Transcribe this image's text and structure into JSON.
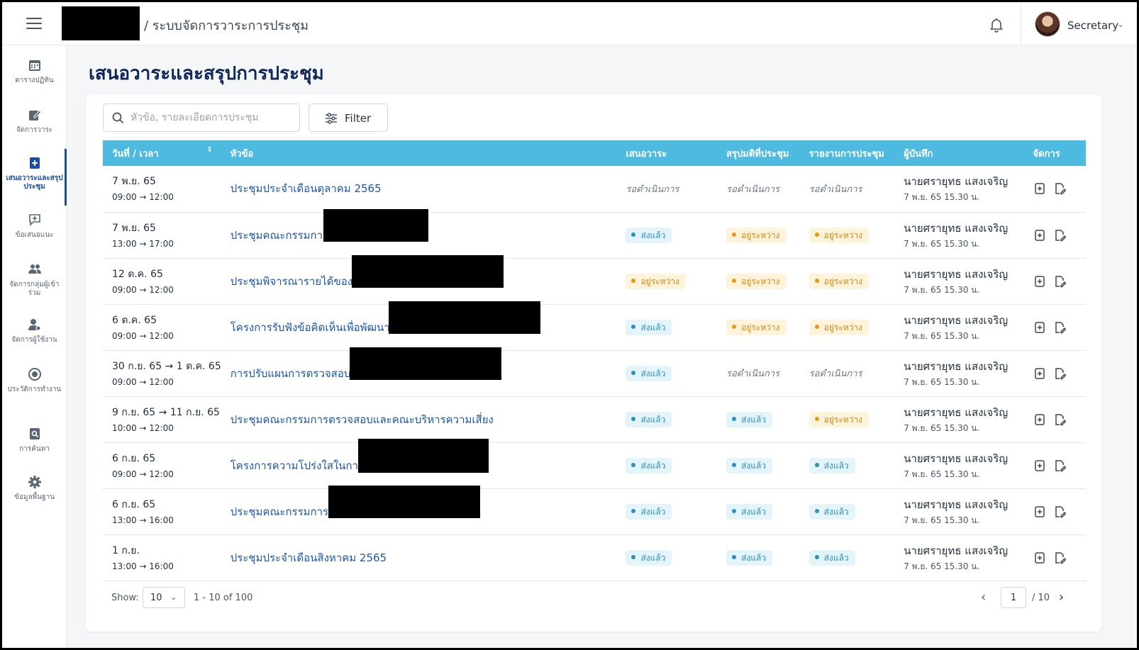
{
  "header": {
    "app_title": "/ ระบบจัดการวาระการประชุม",
    "user_name": "Secretary"
  },
  "sidebar": {
    "items": [
      {
        "label": "ตารางปฏิทิน",
        "icon": "calendar-icon"
      },
      {
        "label": "จัดการวาระ",
        "icon": "edit-icon"
      },
      {
        "label": "เสนอวาระและสรุปประชุม",
        "icon": "add-document-icon",
        "active": true
      },
      {
        "label": "ข้อเสนอแนะ",
        "icon": "chat-plus-icon"
      },
      {
        "label": "จัดการกลุ่มผู้เข้าร่วม",
        "icon": "group-icon"
      },
      {
        "label": "จัดการผู้ใช้งาน",
        "icon": "user-settings-icon"
      },
      {
        "label": "ประวัติการทำงาน",
        "icon": "history-icon"
      },
      {
        "label": "การค้นหา",
        "icon": "search-doc-icon"
      },
      {
        "label": "ข้อมูลพื้นฐาน",
        "icon": "gear-icon"
      }
    ]
  },
  "page": {
    "title": "เสนอวาระและสรุปการประชุม",
    "search_placeholder": "หัวข้อ, รายละเอียดการประชุม",
    "filter_label": "Filter"
  },
  "table": {
    "headers": {
      "datetime": "วันที่ / เวลา",
      "topic": "หัวข้อ",
      "propose": "เสนอวาระ",
      "resolution": "สรุปมติที่ประชุม",
      "report": "รายงานการประชุม",
      "recorder": "ผู้บันทึก",
      "manage": "จัดการ"
    },
    "rows": [
      {
        "date": "7 พ.ย. 65",
        "time": "09:00 → 12:00",
        "topic": "ประชุมประจำเดือนตุลาคม 2565",
        "propose": "รอดำเนินการ",
        "resolution": "รอดำเนินการ",
        "report": "รอดำเนินการ",
        "recorder": "นายศรายุทธ แสงเจริญ",
        "recorded_at": "7 พ.ย. 65 15.30 น."
      },
      {
        "date": "7 พ.ย. 65",
        "time": "13:00 → 17:00",
        "topic": "ประชุมคณะกรรมกา",
        "propose": "ส่งแล้ว",
        "resolution": "อยู่ระหว่าง",
        "report": "อยู่ระหว่าง",
        "recorder": "นายศรายุทธ แสงเจริญ",
        "recorded_at": "7 พ.ย. 65 15.30 น."
      },
      {
        "date": "12 ต.ค. 65",
        "time": "09:00 → 12:00",
        "topic": "ประชุมพิจารณารายได้ของ",
        "propose": "อยู่ระหว่าง",
        "resolution": "อยู่ระหว่าง",
        "report": "อยู่ระหว่าง",
        "recorder": "นายศรายุทธ แสงเจริญ",
        "recorded_at": "7 พ.ย. 65 15.30 น."
      },
      {
        "date": "6 ต.ค. 65",
        "time": "09:00 → 12:00",
        "topic": "โครงการรับฟังข้อคิดเห็นเพื่อพัฒนา",
        "propose": "ส่งแล้ว",
        "resolution": "อยู่ระหว่าง",
        "report": "อยู่ระหว่าง",
        "recorder": "นายศรายุทธ แสงเจริญ",
        "recorded_at": "7 พ.ย. 65 15.30 น."
      },
      {
        "date": "30 ก.ย. 65 → 1 ต.ค. 65",
        "time": "09:00 → 12:00",
        "topic": "การปรับแผนการตรวจสอบ",
        "propose": "ส่งแล้ว",
        "resolution": "รอดำเนินการ",
        "report": "รอดำเนินการ",
        "recorder": "นายศรายุทธ แสงเจริญ",
        "recorded_at": "7 พ.ย. 65 15.30 น."
      },
      {
        "date": "9 ก.ย. 65 → 11 ก.ย. 65",
        "time": "10:00 → 12:00",
        "topic": "ประชุมคณะกรรมการตรวจสอบและคณะบริหารความเสี่ยง",
        "propose": "ส่งแล้ว",
        "resolution": "ส่งแล้ว",
        "report": "อยู่ระหว่าง",
        "recorder": "นายศรายุทธ แสงเจริญ",
        "recorded_at": "7 พ.ย. 65 15.30 น."
      },
      {
        "date": "6 ก.ย. 65",
        "time": "09:00 → 12:00",
        "topic": "โครงการความโปร่งใสในการ",
        "propose": "ส่งแล้ว",
        "resolution": "ส่งแล้ว",
        "report": "ส่งแล้ว",
        "recorder": "นายศรายุทธ แสงเจริญ",
        "recorded_at": "7 พ.ย. 65 15.30 น."
      },
      {
        "date": "6 ก.ย. 65",
        "time": "13:00 → 16:00",
        "topic": "ประชุมคณะกรรมการ",
        "propose": "ส่งแล้ว",
        "resolution": "ส่งแล้ว",
        "report": "ส่งแล้ว",
        "recorder": "นายศรายุทธ แสงเจริญ",
        "recorded_at": "7 พ.ย. 65 15.30 น."
      },
      {
        "date": "1 ก.ย.",
        "time": "13:00 → 16:00",
        "topic": "ประชุมประจำเดือนสิงหาคม 2565",
        "propose": "ส่งแล้ว",
        "resolution": "ส่งแล้ว",
        "report": "ส่งแล้ว",
        "recorder": "นายศรายุทธ แสงเจริญ",
        "recorded_at": "7 พ.ย. 65 15.30 น."
      }
    ]
  },
  "pagination": {
    "show_label": "Show:",
    "page_size": "10",
    "range": "1 - 10 of 100",
    "current_page": "1",
    "total_pages": "/ 10"
  },
  "colors": {
    "header_bg": "#4ebadf",
    "title": "#10275a",
    "link": "#1b56a8",
    "sent": "#2b8fc2",
    "in_progress": "#d48a0f"
  }
}
